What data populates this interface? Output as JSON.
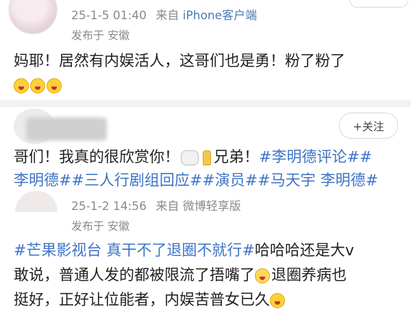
{
  "post1": {
    "timestamp": "25-1-5 01:40",
    "source_prefix": "来自",
    "source": "iPhone客户端",
    "location": "发布于 安徽",
    "text": "妈耶！居然有内娱活人，这哥们也是勇！粉了粉了",
    "emoji_icon": "scream-emoji-icon"
  },
  "post2": {
    "follow_label": "+关注",
    "text_line1_prefix": "哥们！我真的很欣赏你！",
    "text_line1_mid": "兄弟！",
    "text_line1_tag": "#李明德评论##",
    "text_line2": "李明德##三人行剧组回应##演员##马天宇 李明德#"
  },
  "post3": {
    "timestamp": "25-1-2 14:56",
    "source_prefix": "来自",
    "source": "微博轻享版",
    "location": "发布于 安徽",
    "line1_tag": "#芒果影视台 真干不了退圈不就行#",
    "line1_rest": "哈哈哈还是大v",
    "line2": "敢说，普通人发的都被限流了捂嘴了",
    "line2_rest": "退圈养病也",
    "line3": "挺好，正好让位能者，内娱苦普女已久"
  }
}
